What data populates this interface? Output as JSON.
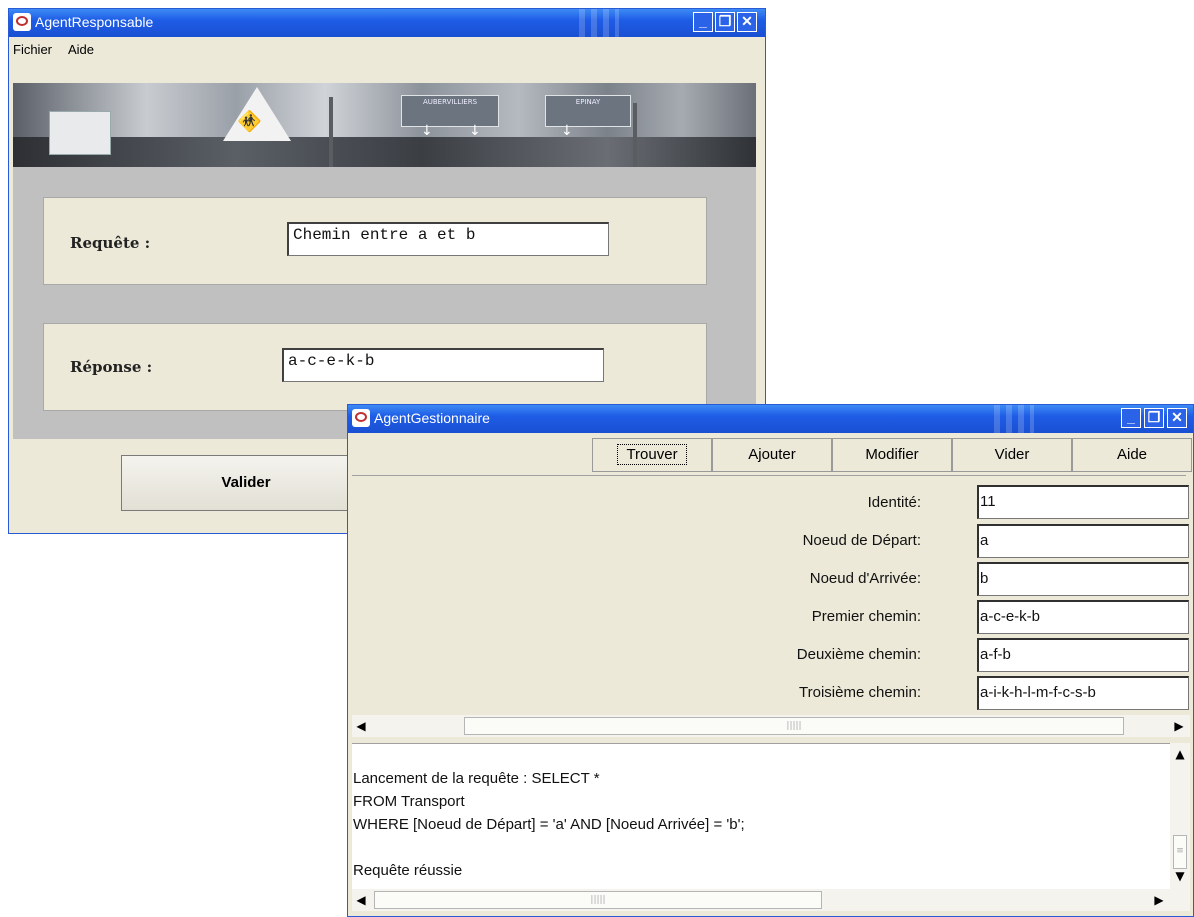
{
  "responsable": {
    "title": "AgentResponsable",
    "menu": [
      "Fichier",
      "Aide"
    ],
    "requete_label": "Requête :",
    "requete_value": "Chemin entre a et b",
    "reponse_label": "Réponse :",
    "reponse_value": "a-c-e-k-b",
    "valider_label": "Valider"
  },
  "gestionnaire": {
    "title": "AgentGestionnaire",
    "toolbar": [
      "Trouver",
      "Ajouter",
      "Modifier",
      "Vider",
      "Aide"
    ],
    "fields": [
      {
        "label": "Identité:",
        "value": "11"
      },
      {
        "label": "Noeud de Départ:",
        "value": "a"
      },
      {
        "label": "Noeud d'Arrivée:",
        "value": "b"
      },
      {
        "label": "Premier chemin:",
        "value": "a-c-e-k-b"
      },
      {
        "label": "Deuxième chemin:",
        "value": "a-f-b"
      },
      {
        "label": "Troisième chemin:",
        "value": "a-i-k-h-l-m-f-c-s-b"
      }
    ],
    "log": [
      "Lancement de la requête : SELECT *",
      "FROM Transport",
      "WHERE [Noeud de Départ] = 'a' AND [Noeud Arrivée] = 'b';",
      "",
      "Requête réussie"
    ]
  },
  "banner_signs": [
    "AUBERVILLIERS",
    "EPINAY"
  ],
  "icons": {
    "app": "java-cup-icon",
    "minimize": "minimize-icon",
    "restore": "restore-icon",
    "close": "close-icon"
  },
  "colors": {
    "titlebar": "#1e5ce6",
    "window_bg": "#ece9d8",
    "content_gray": "#c0c0c0"
  }
}
